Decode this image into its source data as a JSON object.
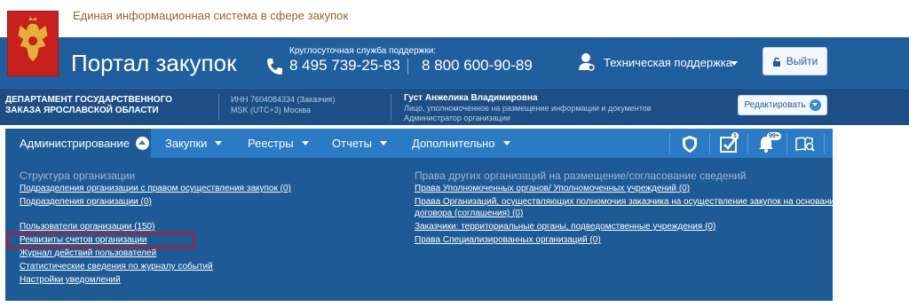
{
  "header": {
    "system_title": "Единая информационная система в сфере закупок",
    "portal_title": "Портал закупок",
    "support_label": "Круглосуточная служба поддержки:",
    "phone1": "8 495 739-25-83",
    "phone2": "8 800 600-90-89",
    "tech_support": "Техническая поддержка",
    "logout": "Выйти"
  },
  "org": {
    "name": "ДЕПАРТАМЕНТ ГОСУДАРСТВЕННОГО ЗАКАЗА ЯРОСЛАВСКОЙ ОБЛАСТИ",
    "inn": "ИНН 7604084334 (Заказчик)",
    "timezone": "MSK (UTC+3) Москва",
    "user_name": "Густ Анжелика Владимировна",
    "user_role_1": "Лицо, уполномоченное на размещение информации и документов",
    "user_role_2": "Администратор организации",
    "edit_button": "Редактировать"
  },
  "nav": {
    "items": [
      {
        "label": "Администрирование"
      },
      {
        "label": "Закупки"
      },
      {
        "label": "Реестры"
      },
      {
        "label": "Отчеты"
      },
      {
        "label": "Дополнительно"
      }
    ],
    "icons": [
      "shield-icon",
      "checklist-icon",
      "bell-icon",
      "book-search-icon"
    ],
    "badges": {
      "checklist": "1",
      "bell": "99+"
    }
  },
  "dropdown": {
    "left_heading": "Структура организации",
    "left_links": [
      "Подразделения организации с правом осуществления закупок (0)",
      "Подразделения организации (0)",
      "Пользователи организации (150)",
      "Реквизиты счетов организации",
      "Журнал действий пользователей",
      "Статистические сведения по журналу событий",
      "Настройки уведомлений"
    ],
    "right_heading": "Права других организаций на размещение/согласование сведений",
    "right_links": [
      "Права Уполномоченных органов/ Уполномоченных учреждений (0)",
      "Права Организаций, осуществляющих полномочия заказчика на осуществление закупок на основании",
      "договора (соглашения) (0)",
      "Заказчики: территориальные органы, подведомственные учреждения (0)",
      "Права Специализированных организаций (0)"
    ]
  },
  "colors": {
    "header": "#1f5f9e",
    "orgbar": "#1d4f86",
    "nav": "#2b7ac4",
    "nav_active": "#1e5b96",
    "highlight": "#d0121b"
  }
}
